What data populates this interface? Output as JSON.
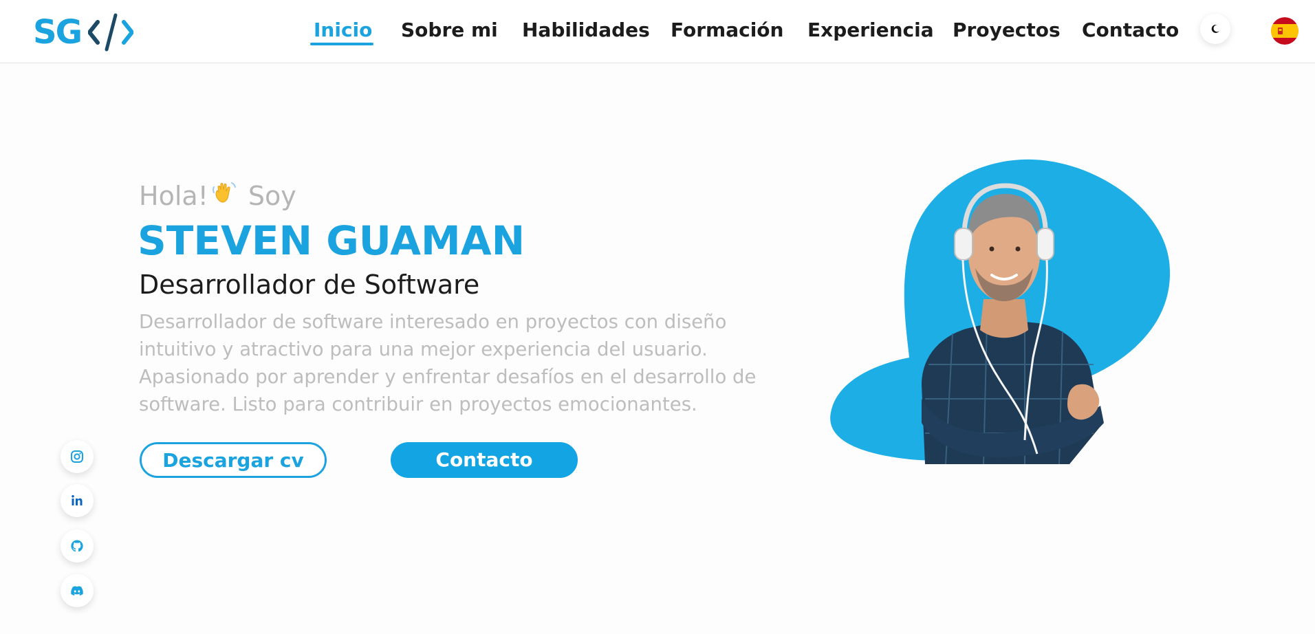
{
  "logo": {
    "text": "SG"
  },
  "nav": {
    "items": [
      {
        "label": "Inicio",
        "active": true
      },
      {
        "label": "Sobre mi"
      },
      {
        "label": "Habilidades"
      },
      {
        "label": "Formación"
      },
      {
        "label": "Experiencia"
      },
      {
        "label": "Proyectos"
      },
      {
        "label": "Contacto"
      }
    ],
    "theme_icon": "moon-icon",
    "language_icon": "spain-flag-icon"
  },
  "hero": {
    "greeting": "Hola!",
    "greeting_suffix": "Soy",
    "name": "STEVEN GUAMAN",
    "role": "Desarrollador de Software",
    "description": "Desarrollador de software interesado en proyectos con diseño intuitivo y atractivo para una mejor experiencia del usuario. Apasionado por aprender y enfrentar desafíos en el desarrollo de software. Listo para contribuir en proyectos emocionantes.",
    "buttons": {
      "download_cv": "Descargar cv",
      "contact": "Contacto"
    }
  },
  "social": [
    "instagram-icon",
    "linkedin-icon",
    "github-icon",
    "discord-icon"
  ],
  "colors": {
    "accent": "#1aa3df",
    "blob": "#1eaee6",
    "shirt": "#1e3a55"
  }
}
